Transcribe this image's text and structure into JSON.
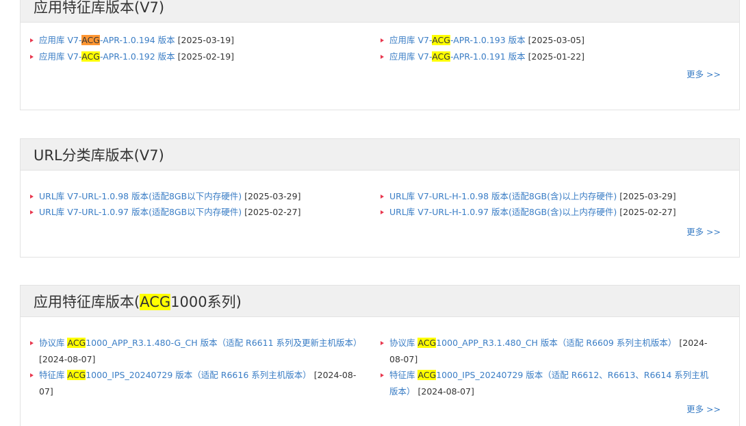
{
  "panels": [
    {
      "title": "应用特征库版本(V7)",
      "more_label": "更多 >>",
      "items": [
        {
          "prefix": "应用库 V7-",
          "hl": "ACG",
          "suffix": "-APR-1.0.194 版本",
          "date": "[2025-03-19]"
        },
        {
          "prefix": "应用库 V7-",
          "hl": "ACG",
          "suffix": "-APR-1.0.193 版本",
          "date": "[2025-03-05]"
        },
        {
          "prefix": "应用库 V7-",
          "hl": "ACG",
          "suffix": "-APR-1.0.192 版本",
          "date": "[2025-02-19]"
        },
        {
          "prefix": "应用库 V7-",
          "hl": "ACG",
          "suffix": "-APR-1.0.191 版本",
          "date": "[2025-01-22]"
        }
      ]
    },
    {
      "title": "URL分类库版本(V7)",
      "more_label": "更多 >>",
      "items": [
        {
          "text": "URL库 V7-URL-1.0.98 版本(适配8GB以下内存硬件)",
          "date": "[2025-03-29]"
        },
        {
          "text": "URL库 V7-URL-H-1.0.98 版本(适配8GB(含)以上内存硬件)",
          "date": "[2025-03-29]"
        },
        {
          "text": "URL库 V7-URL-1.0.97 版本(适配8GB以下内存硬件)",
          "date": "[2025-02-27]"
        },
        {
          "text": "URL库 V7-URL-H-1.0.97 版本(适配8GB(含)以上内存硬件)",
          "date": "[2025-02-27]"
        }
      ]
    },
    {
      "title_prefix": "应用特征库版本(",
      "title_hl": "ACG",
      "title_suffix": "1000系列)",
      "more_label": "更多 >>",
      "items": [
        {
          "prefix": "协议库 ",
          "hl": "ACG",
          "suffix": "1000_APP_R3.1.480-G_CH 版本（适配 R6611 系列及更新主机版本）",
          "date": "[2024-08-07]"
        },
        {
          "prefix": "协议库 ",
          "hl": "ACG",
          "suffix": "1000_APP_R3.1.480_CH 版本（适配 R6609 系列主机版本）",
          "date": "[2024-08-07]"
        },
        {
          "prefix": "特征库 ",
          "hl": "ACG",
          "suffix": "1000_IPS_20240729 版本（适配 R6616 系列主机版本）",
          "date": "[2024-08-07]"
        },
        {
          "prefix": "特征库 ",
          "hl": "ACG",
          "suffix": "1000_IPS_20240729 版本（适配 R6612、R6613、R6614 系列主机版本）",
          "date": "[2024-08-07]"
        }
      ]
    }
  ],
  "colors": {
    "link": "#3a7dc5",
    "bullet": "#e8384f",
    "highlight": "#ffff00",
    "highlight_active": "#ff9632",
    "header_bg": "#f0f0f0"
  }
}
